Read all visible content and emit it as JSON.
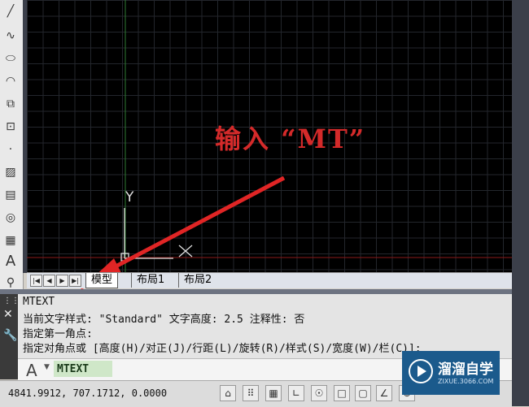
{
  "left_toolbar": {
    "tools": [
      {
        "icon": "line-icon"
      },
      {
        "icon": "spline-icon"
      },
      {
        "icon": "ellipse-icon"
      },
      {
        "icon": "ellipse-arc-icon"
      },
      {
        "icon": "insert-block-icon"
      },
      {
        "icon": "make-block-icon"
      },
      {
        "icon": "point-icon"
      },
      {
        "icon": "hatch-icon"
      },
      {
        "icon": "gradient-icon"
      },
      {
        "icon": "region-icon"
      },
      {
        "icon": "table-icon"
      },
      {
        "icon": "mtext-icon",
        "label": "A"
      },
      {
        "icon": "add-selected-icon"
      }
    ]
  },
  "canvas": {
    "ucs": {
      "y_label": "Y",
      "x_label": "X"
    },
    "colors": {
      "background": "#000000",
      "grid": "#23262c",
      "y_axis": "#2e7d32",
      "x_axis": "#8b1a1a",
      "ucs": "#e0e0e0"
    }
  },
  "annotation": {
    "text": "输入 “MT”",
    "color": "#d42a2a"
  },
  "layout_tabs": {
    "tabs": [
      {
        "label": "模型",
        "active": true
      },
      {
        "label": "布局1",
        "active": false
      },
      {
        "label": "布局2",
        "active": false
      }
    ]
  },
  "command_window": {
    "lines": [
      "MTEXT",
      "当前文字样式: \"Standard\"  文字高度:  2.5  注释性:  否",
      "指定第一角点:",
      "指定对角点或 [高度(H)/对正(J)/行距(L)/旋转(R)/样式(S)/宽度(W)/栏(C)]:"
    ],
    "prompt_icon": "A",
    "input_value": "MTEXT"
  },
  "status_bar": {
    "coordinates": "4841.9912, 707.1712, 0.0000",
    "buttons": [
      "infer-icon",
      "snap-icon",
      "grid-icon",
      "ortho-icon",
      "polar-icon",
      "osnap-icon",
      "3dosnap-icon",
      "otrack-icon",
      "ducs-icon"
    ]
  },
  "watermark": {
    "title": "溜溜自学",
    "subtitle": "ZIXUE.3066.COM"
  }
}
